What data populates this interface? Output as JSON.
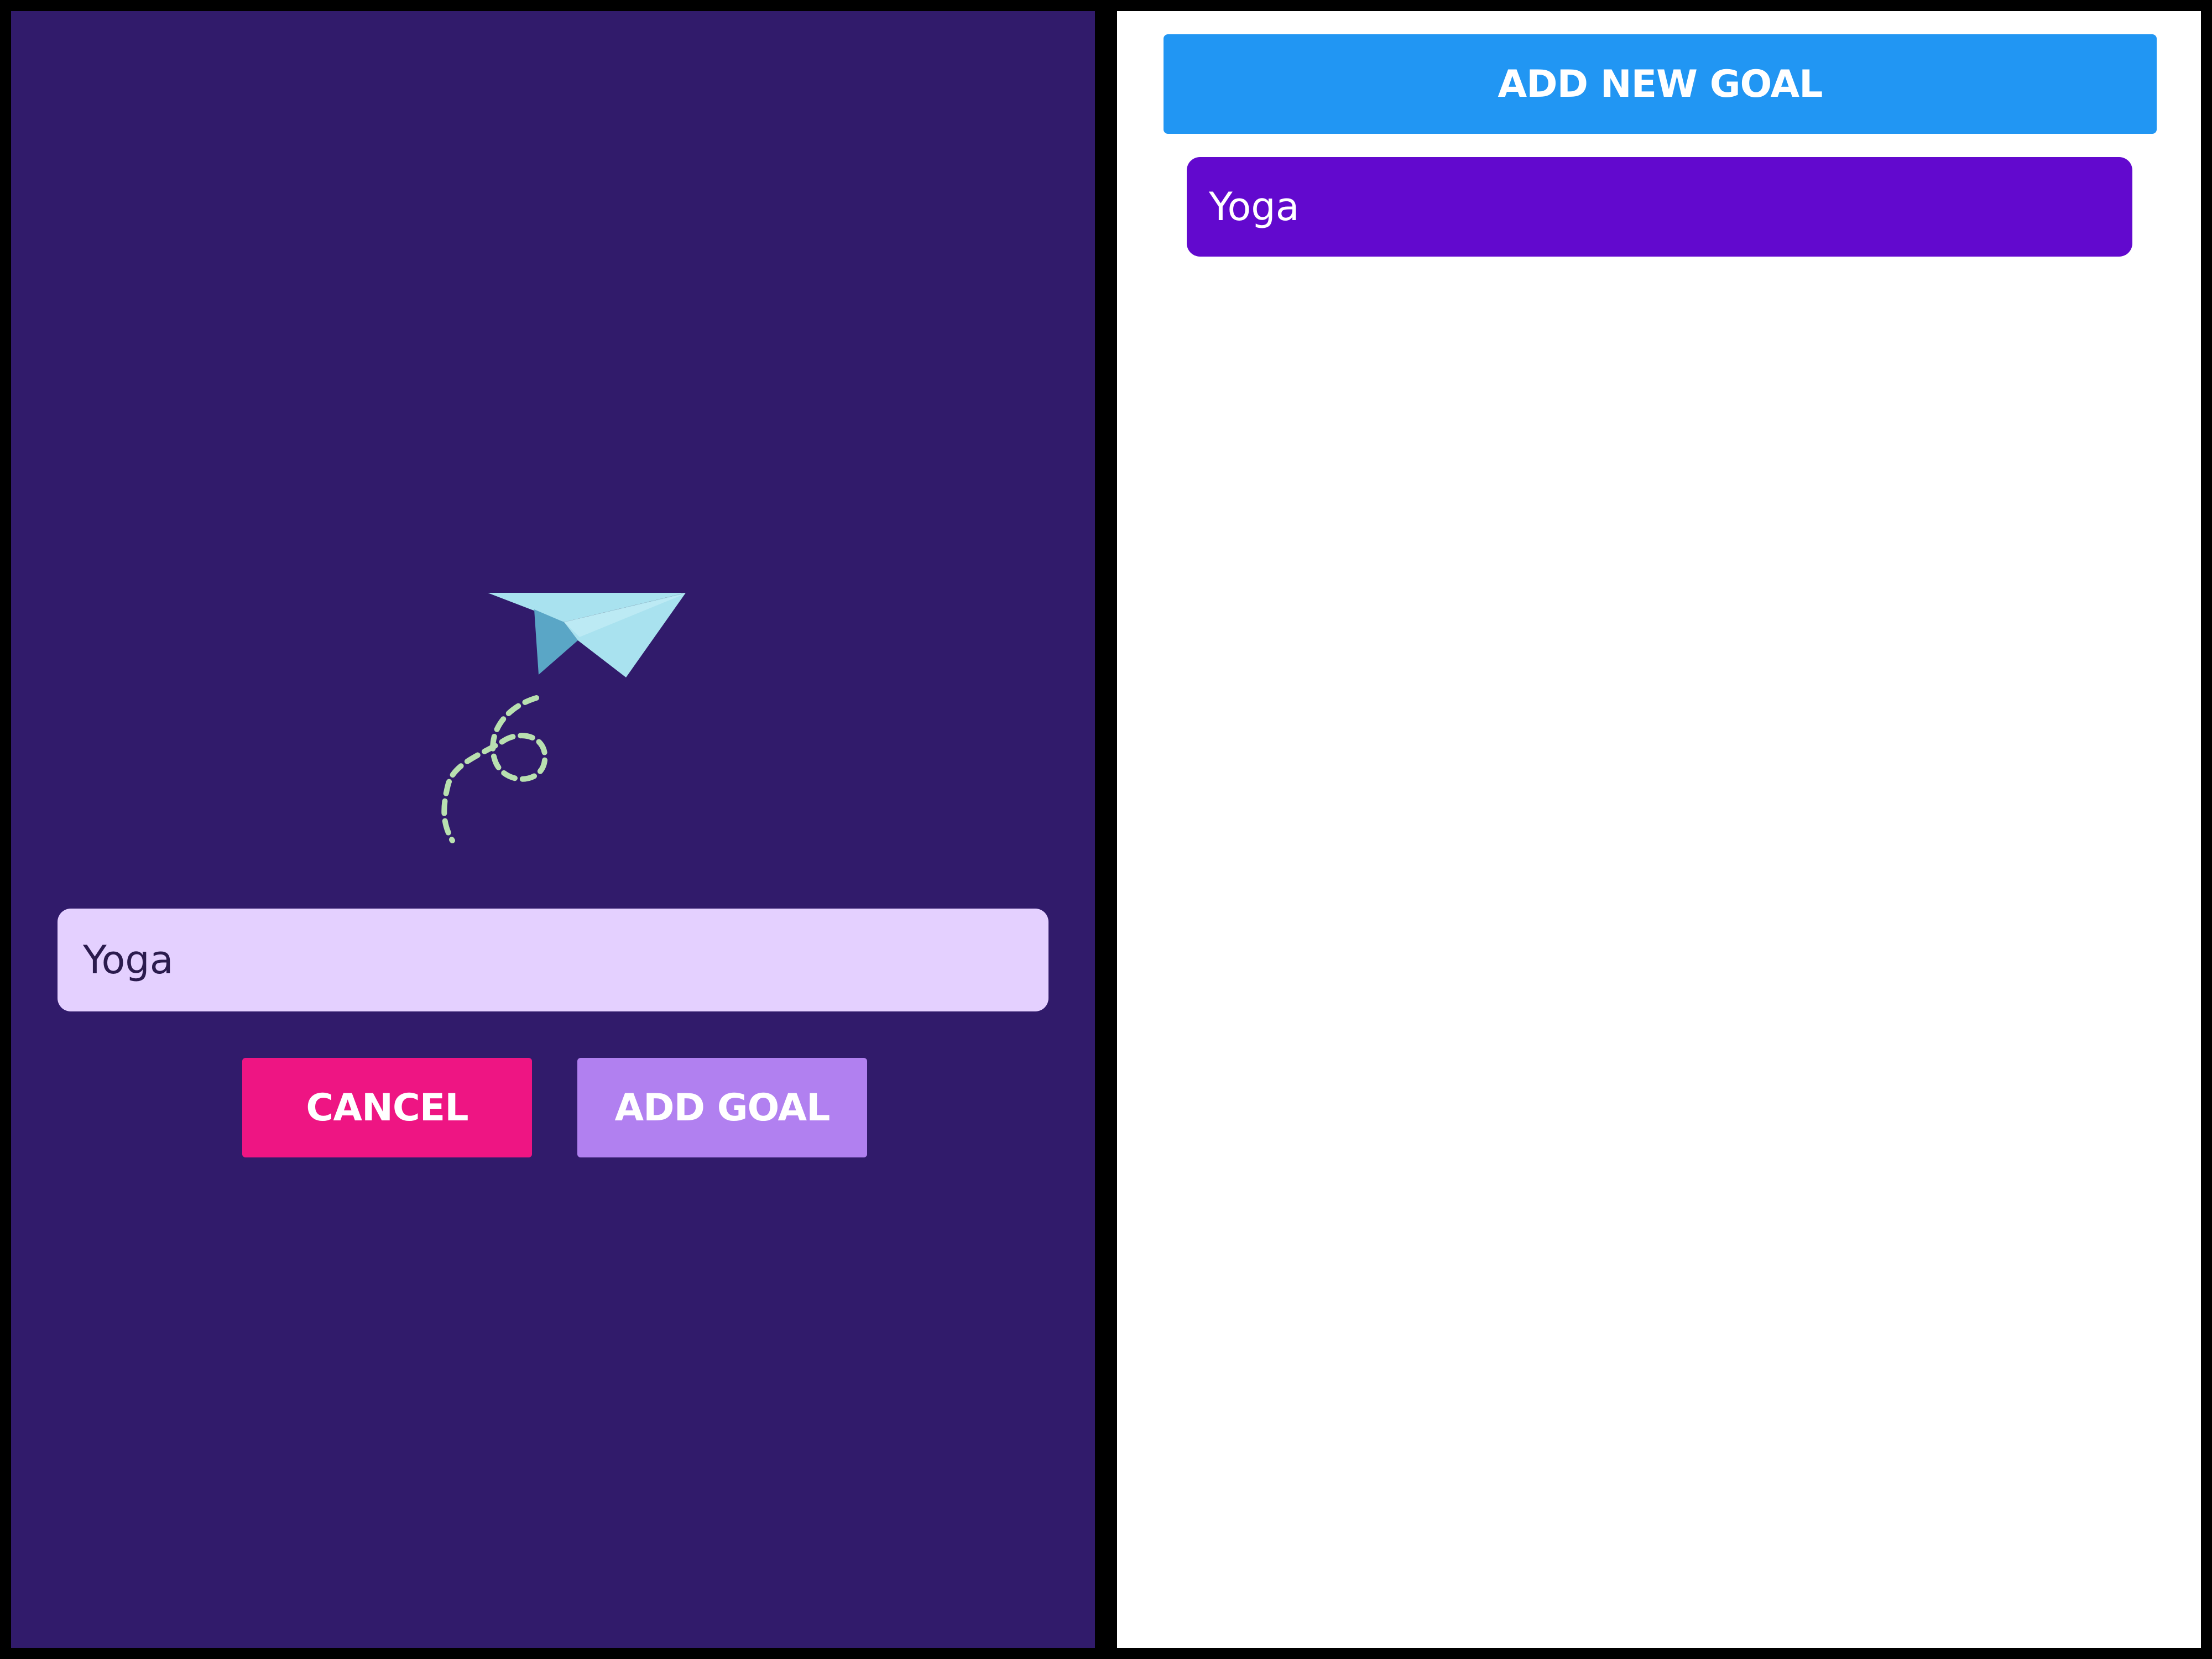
{
  "left_screen": {
    "illustration": "paper-plane-icon",
    "goal_input": {
      "value": "Yoga",
      "placeholder": ""
    },
    "cancel_label": "CANCEL",
    "add_goal_label": "ADD GOAL"
  },
  "right_screen": {
    "add_new_goal_label": "ADD NEW GOAL",
    "goals": [
      {
        "text": "Yoga"
      }
    ]
  },
  "colors": {
    "modal_background": "#311b6b",
    "input_background": "#e4d0ff",
    "cancel": "#ee1583",
    "add_goal": "#b180f0",
    "add_new_goal": "#2196f3",
    "goal_item": "#6209ce"
  }
}
